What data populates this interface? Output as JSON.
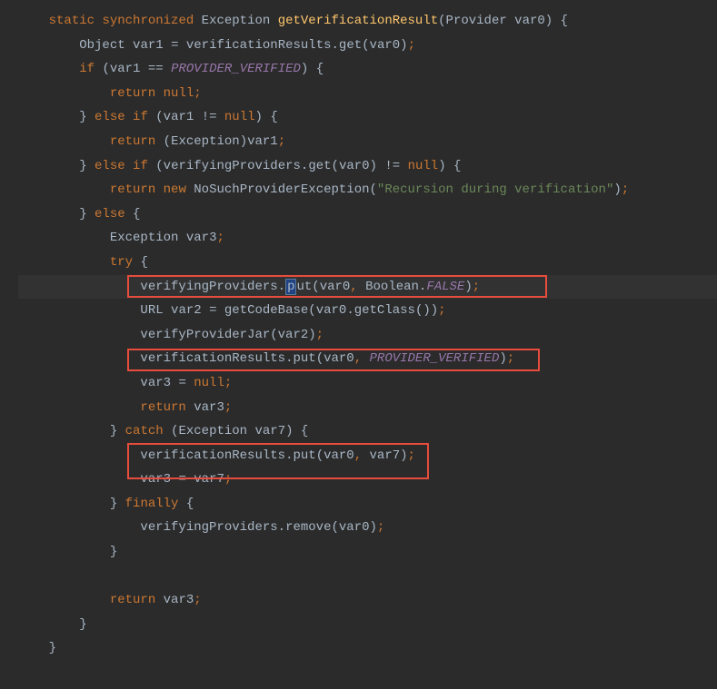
{
  "code": {
    "l1_static": "static",
    "l1_sync": "synchronized",
    "l1_type": "Exception",
    "l1_method": "getVerificationResult",
    "l1_param_type": "Provider",
    "l1_param": "var0",
    "l2_type": "Object",
    "l2_var": "var1",
    "l2_eq": "=",
    "l2_obj": "verificationResults",
    "l2_method": "get",
    "l2_arg": "var0",
    "l3_if": "if",
    "l3_var": "var1",
    "l3_op": "==",
    "l3_const": "PROVIDER_VERIFIED",
    "l4_return": "return",
    "l4_null": "null",
    "l5_else": "else",
    "l5_if": "if",
    "l5_var": "var1",
    "l5_op": "!=",
    "l5_null": "null",
    "l6_return": "return",
    "l6_cast": "Exception",
    "l6_var": "var1",
    "l7_else": "else",
    "l7_if": "if",
    "l7_obj": "verifyingProviders",
    "l7_method": "get",
    "l7_arg": "var0",
    "l7_op": "!=",
    "l7_null": "null",
    "l8_return": "return",
    "l8_new": "new",
    "l8_type": "NoSuchProviderException",
    "l8_str": "\"Recursion during verification\"",
    "l9_else": "else",
    "l10_type": "Exception",
    "l10_var": "var3",
    "l11_try": "try",
    "l12_obj": "verifyingProviders",
    "l12_method": "put",
    "l12_arg1": "var0",
    "l12_arg2a": "Boolean",
    "l12_arg2b": "FALSE",
    "l13_type": "URL",
    "l13_var": "var2",
    "l13_eq": "=",
    "l13_method": "getCodeBase",
    "l13_arg": "var0",
    "l13_method2": "getClass",
    "l14_method": "verifyProviderJar",
    "l14_arg": "var2",
    "l15_obj": "verificationResults",
    "l15_method": "put",
    "l15_arg1": "var0",
    "l15_arg2": "PROVIDER_VERIFIED",
    "l16_var": "var3",
    "l16_eq": "=",
    "l16_null": "null",
    "l17_return": "return",
    "l17_var": "var3",
    "l18_catch": "catch",
    "l18_type": "Exception",
    "l18_var": "var7",
    "l19_obj": "verificationResults",
    "l19_method": "put",
    "l19_arg1": "var0",
    "l19_arg2": "var7",
    "l20_var": "var3",
    "l20_eq": "=",
    "l20_val": "var7",
    "l21_finally": "finally",
    "l22_obj": "verifyingProviders",
    "l22_method": "remove",
    "l22_arg": "var0",
    "l25_return": "return",
    "l25_var": "var3"
  }
}
